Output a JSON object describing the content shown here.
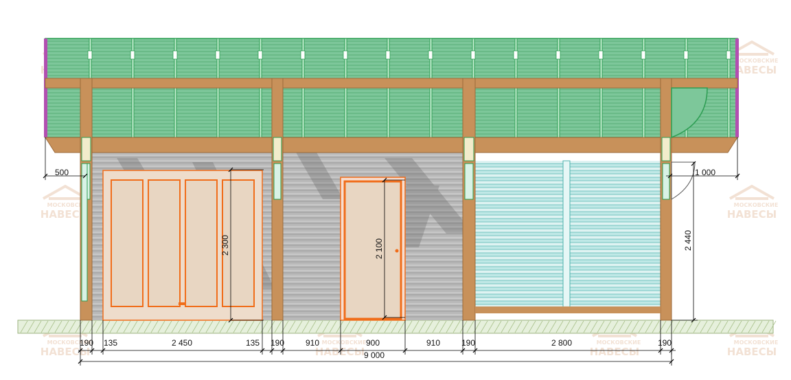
{
  "colors": {
    "timber": "#c8915a",
    "timber_dark": "#a87346",
    "roof_green": "#6fbf8d",
    "roof_line": "#2c9d52",
    "wall_grey": "#b9b9b9",
    "wall_line": "#9a9a9a",
    "slat_teal": "#bfe8e6",
    "slat_line": "#4fb3ad",
    "door_fill": "#e8d6c2",
    "door_frame": "#f06d1a",
    "ground": "#e6f0dc",
    "ground_hatch": "#a8c08a",
    "watermark": "#e9c9b2"
  },
  "watermark": {
    "line1": "МОСКОВСКИЕ",
    "line2": "НАВЕСЫ"
  },
  "dimensions": {
    "overhang_left": "500",
    "overhang_right": "1 000",
    "height_gate": "2 300",
    "height_door": "2 100",
    "height_total": "2 440",
    "post_1": "190",
    "gap_1a": "135",
    "gate_width": "2 450",
    "gap_1b": "135",
    "post_2": "190",
    "gap_2a": "910",
    "door_width": "900",
    "gap_2b": "910",
    "post_3": "190",
    "bay_3": "2 800",
    "post_4": "190",
    "total": "9 000"
  }
}
